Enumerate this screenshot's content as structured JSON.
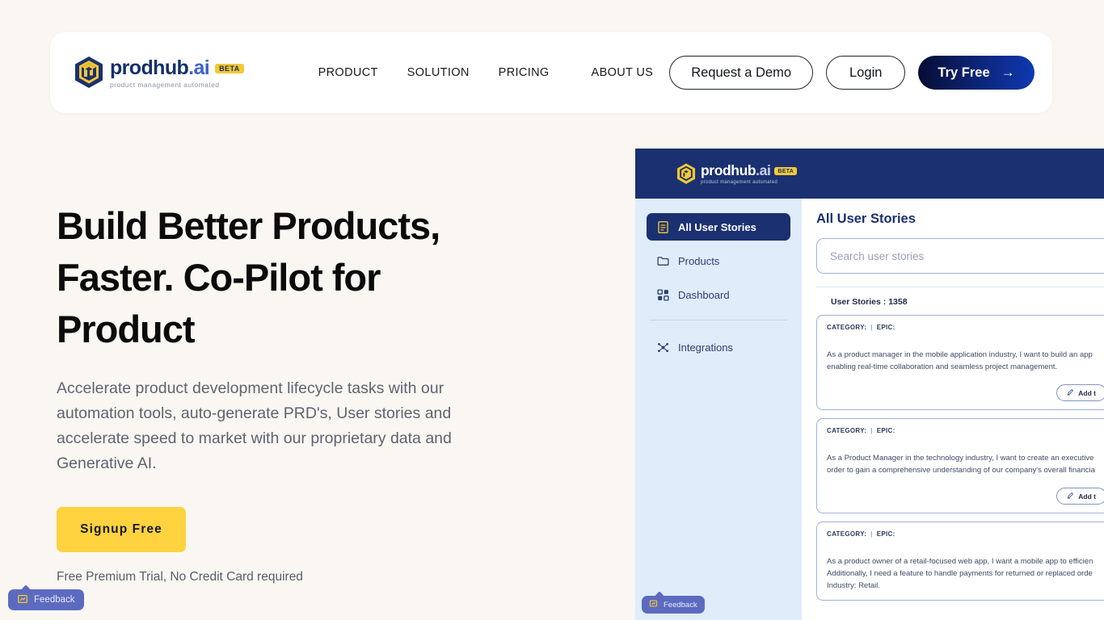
{
  "brand": {
    "name_main": "prodhub",
    "name_suffix": ".ai",
    "badge": "BETA",
    "tagline": "product management automated"
  },
  "nav": {
    "links": [
      {
        "label": "PRODUCT"
      },
      {
        "label": "SOLUTION"
      },
      {
        "label": "PRICING"
      },
      {
        "label": "ABOUT US"
      }
    ],
    "request_demo": "Request a Demo",
    "login": "Login",
    "try_free": "Try Free",
    "try_free_arrow": "→"
  },
  "hero": {
    "title_line1": "Build Better Products,",
    "title_line2": "Faster. Co-Pilot for",
    "title_line3": "Product",
    "subtitle": "Accelerate product development lifecycle tasks with our automation tools, auto-generate PRD's, User stories and accelerate speed to market with our proprietary data and Generative AI.",
    "cta_label": "Signup Free",
    "note": "Free Premium Trial, No Credit Card required"
  },
  "app": {
    "logo": {
      "name_main": "prodhub",
      "name_suffix": ".ai",
      "badge": "BETA",
      "tagline": "product management automated"
    },
    "sidebar": {
      "items": [
        {
          "label": "All User Stories",
          "icon": "document-icon",
          "active": true
        },
        {
          "label": "Products",
          "icon": "folder-icon",
          "active": false
        },
        {
          "label": "Dashboard",
          "icon": "grid-icon",
          "active": false
        },
        {
          "label": "Integrations",
          "icon": "integrations-icon",
          "active": false
        }
      ]
    },
    "content": {
      "title": "All User Stories",
      "search_placeholder": "Search user stories",
      "count_label": "User Stories : 1358",
      "meta_category": "CATEGORY:",
      "meta_epic": "EPIC:",
      "meta_separator": "|",
      "add_button_label": "Add t",
      "stories": [
        {
          "text": "As a product manager in the mobile application industry, I want to build an app enabling real-time collaboration and seamless project management."
        },
        {
          "text": "As a Product Manager in the technology industry, I want to create an executive order to gain a comprehensive understanding of our company's overall financia"
        },
        {
          "text": "As a product owner of a retail-focused web app, I want a mobile app to efficien Additionally, I need a feature to handle payments for returned or replaced orde Industry: Retail."
        }
      ]
    }
  },
  "feedback": {
    "main_label": "Feedback",
    "app_label": "Feedback"
  },
  "colors": {
    "page_background": "#faf6f2",
    "brand_navy": "#15306b",
    "brand_yellow": "#f6c832",
    "cta_yellow": "#ffd23f",
    "app_header_navy": "#1b3070",
    "app_sidebar_blue": "#dfecfa",
    "feedback_purple": "#5c6bc0"
  }
}
